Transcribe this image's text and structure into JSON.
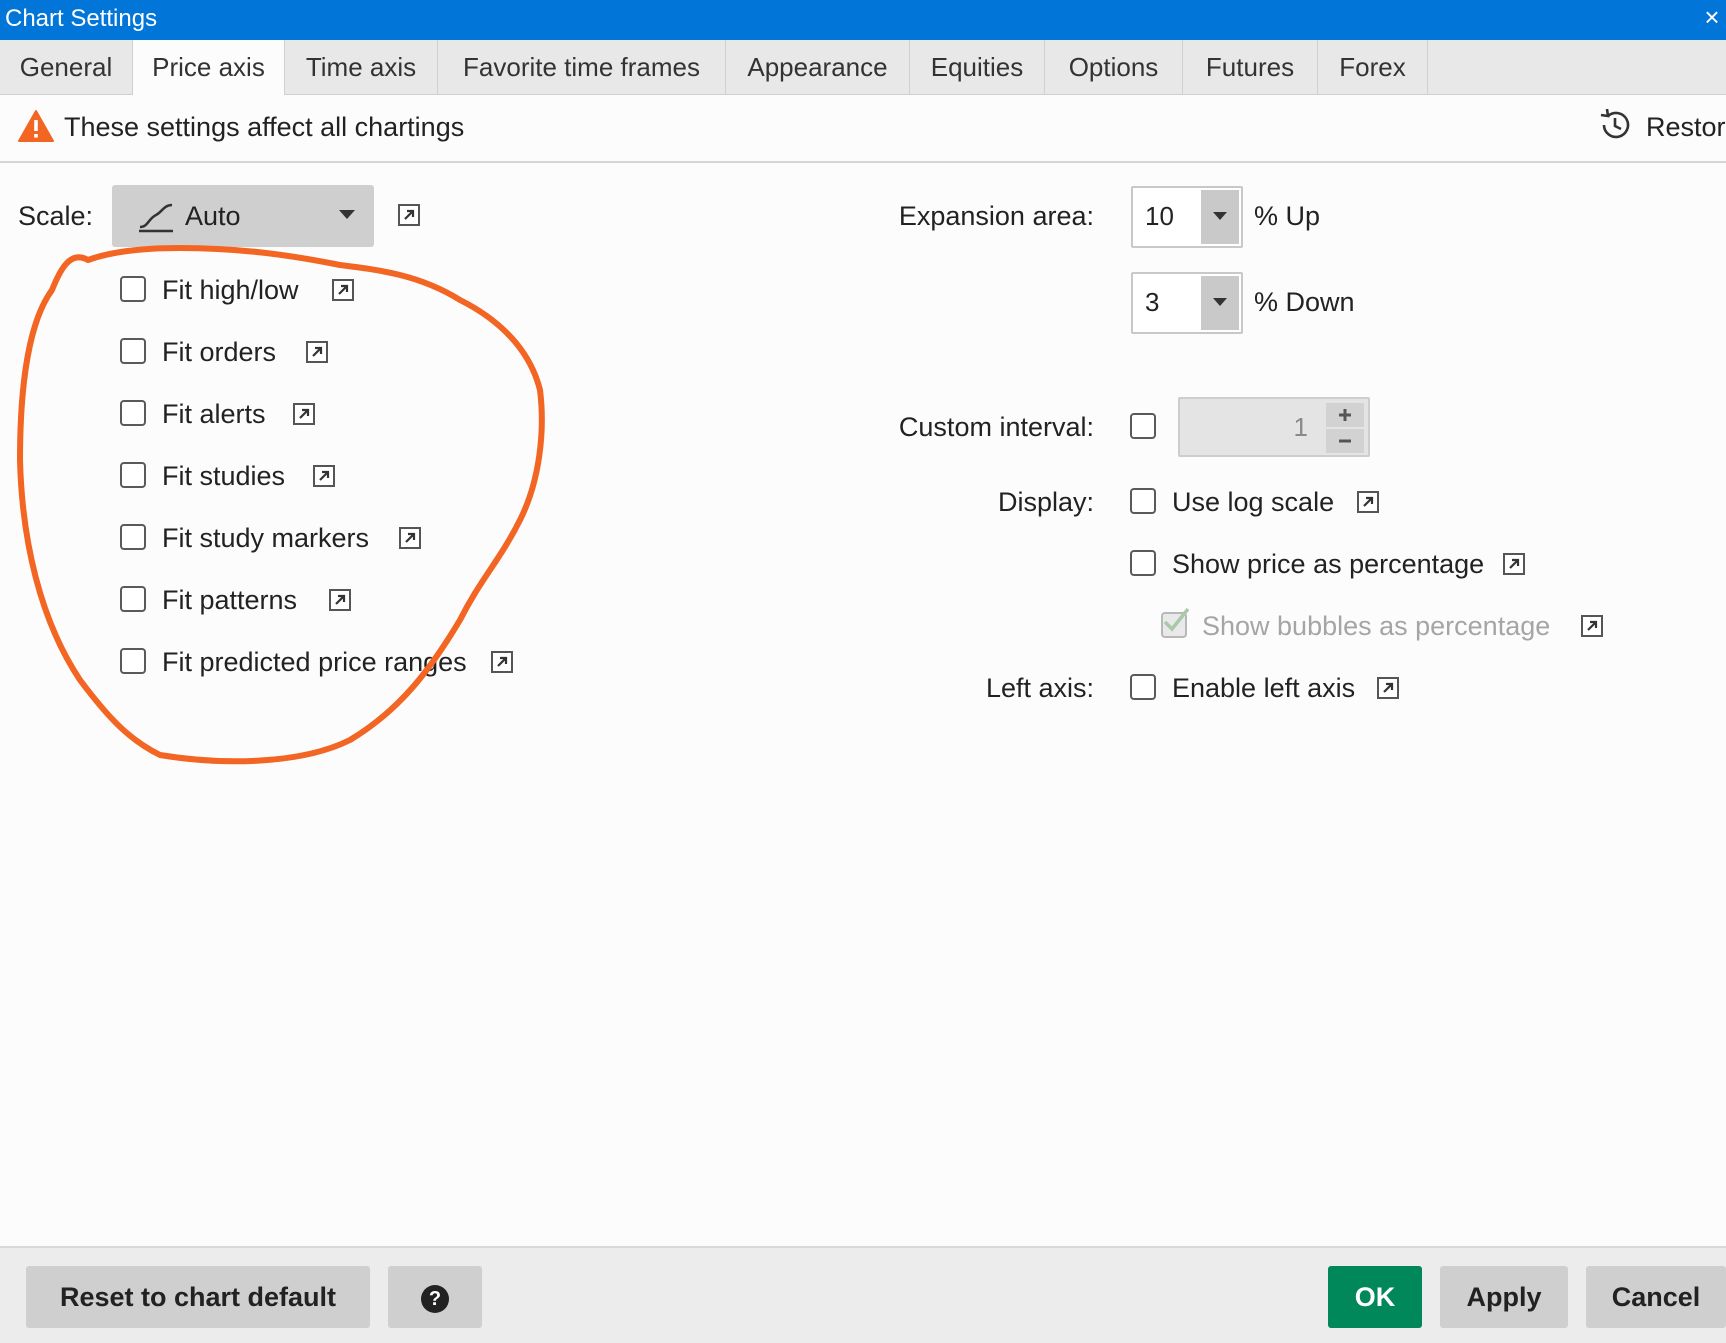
{
  "window": {
    "title": "Chart Settings"
  },
  "tabs": [
    {
      "label": "General"
    },
    {
      "label": "Price axis",
      "active": true
    },
    {
      "label": "Time axis"
    },
    {
      "label": "Favorite time frames"
    },
    {
      "label": "Appearance"
    },
    {
      "label": "Equities"
    },
    {
      "label": "Options"
    },
    {
      "label": "Futures"
    },
    {
      "label": "Forex"
    }
  ],
  "notice": {
    "text": "These settings affect all chartings",
    "restore_label": "Restor"
  },
  "scale": {
    "label": "Scale:",
    "value": "Auto"
  },
  "fit_options": [
    {
      "label": "Fit high/low",
      "checked": false
    },
    {
      "label": "Fit orders",
      "checked": false
    },
    {
      "label": "Fit alerts",
      "checked": false
    },
    {
      "label": "Fit studies",
      "checked": false
    },
    {
      "label": "Fit study markers",
      "checked": false
    },
    {
      "label": "Fit patterns",
      "checked": false
    },
    {
      "label": "Fit predicted price ranges",
      "checked": false
    }
  ],
  "expansion": {
    "label": "Expansion area:",
    "up_value": "10",
    "up_label": "% Up",
    "down_value": "3",
    "down_label": "% Down"
  },
  "custom_interval": {
    "label": "Custom interval:",
    "checked": false,
    "value": "1"
  },
  "display": {
    "label": "Display:",
    "log_scale": "Use log scale",
    "price_pct": "Show price as percentage",
    "bubbles_pct": "Show bubbles as percentage"
  },
  "left_axis": {
    "label": "Left axis:",
    "enable": "Enable left axis"
  },
  "buttons": {
    "reset": "Reset to chart default",
    "help": "?",
    "ok": "OK",
    "apply": "Apply",
    "cancel": "Cancel"
  },
  "colors": {
    "titlebar": "#0275d8",
    "ok_button": "#00875a",
    "annotation_circle": "#f26522",
    "warning": "#f26522"
  }
}
